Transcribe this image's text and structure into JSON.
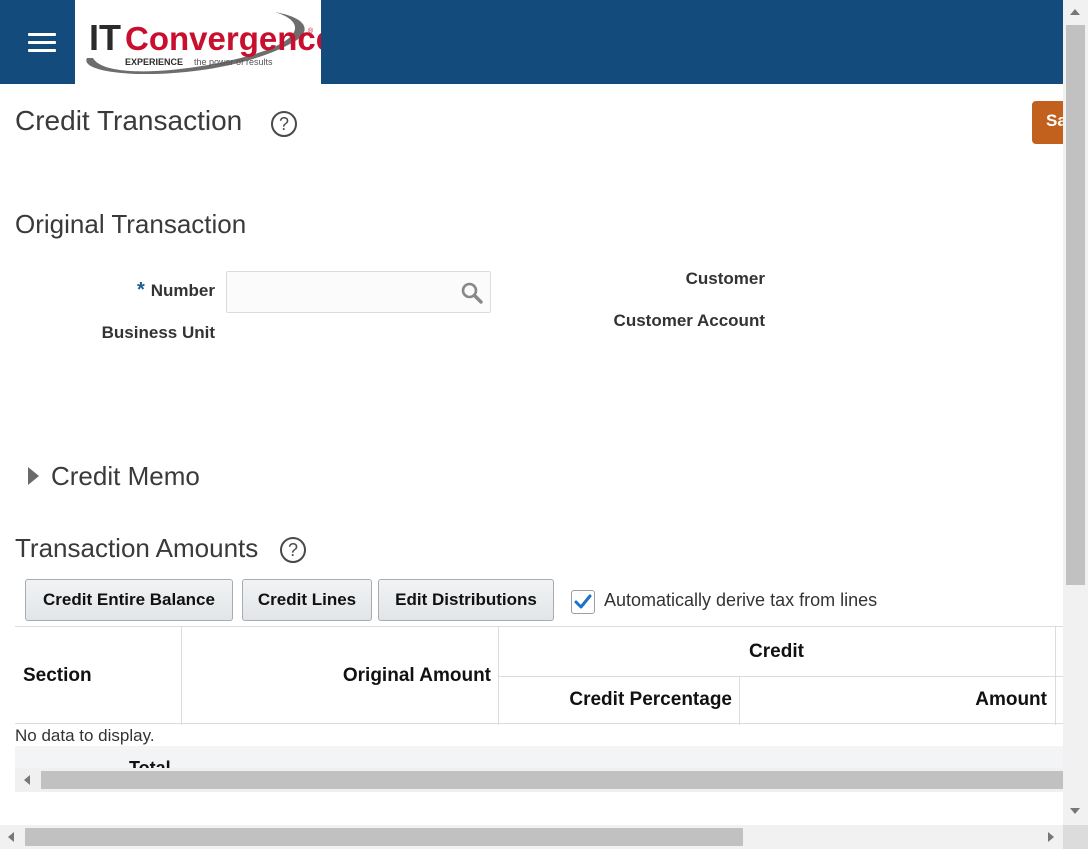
{
  "header": {
    "menu_icon": "hamburger-menu-icon",
    "logo_text_it": "IT",
    "logo_text_conv": "Convergence",
    "logo_registered": "®",
    "logo_tagline_bold": "EXPERIENCE",
    "logo_tagline": "the power of results",
    "brand_color": "#134b7c",
    "logo_red": "#c8102e"
  },
  "page": {
    "title": "Credit Transaction",
    "help_glyph": "?",
    "save_label": "Sa",
    "save_color": "#c2601d"
  },
  "original_transaction": {
    "heading": "Original Transaction",
    "required_mark": "*",
    "number_label": "Number",
    "number_value": "",
    "business_unit_label": "Business Unit",
    "customer_label": "Customer",
    "customer_account_label": "Customer Account"
  },
  "credit_memo": {
    "heading": "Credit Memo",
    "expanded": false
  },
  "transaction_amounts": {
    "heading": "Transaction Amounts",
    "buttons": {
      "credit_entire_balance": "Credit Entire Balance",
      "credit_lines": "Credit Lines",
      "edit_distributions": "Edit Distributions"
    },
    "auto_tax_label": "Automatically derive tax from lines",
    "auto_tax_checked": true,
    "columns": {
      "section": "Section",
      "original_amount": "Original Amount",
      "credit_group": "Credit",
      "credit_percentage": "Credit Percentage",
      "amount": "Amount"
    },
    "empty_text": "No data to display.",
    "total_label": "Total"
  }
}
